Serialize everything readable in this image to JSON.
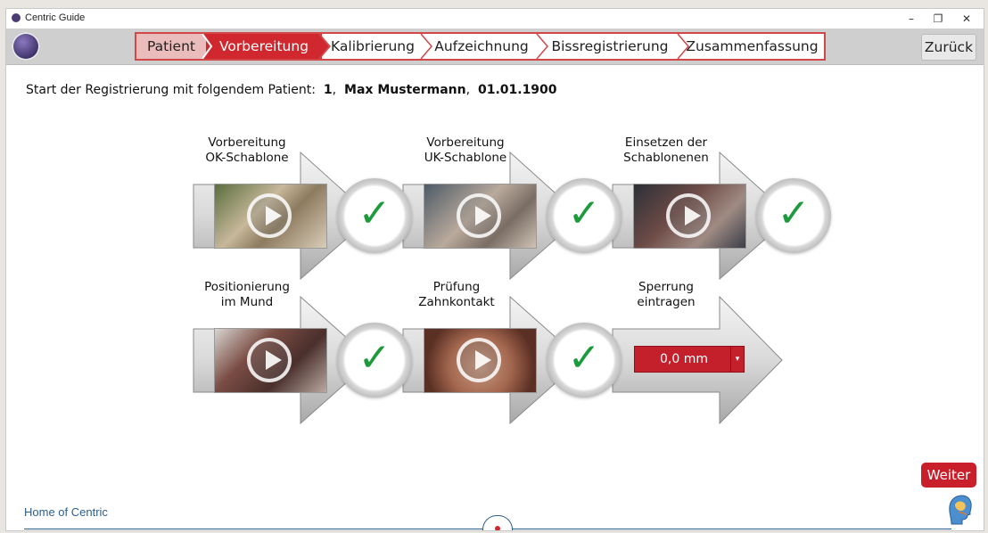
{
  "window": {
    "title": "Centric Guide",
    "minimize": "–",
    "maximize": "❐",
    "close": "✕"
  },
  "steps": [
    {
      "label": "Patient",
      "state": "done"
    },
    {
      "label": "Vorbereitung",
      "state": "active"
    },
    {
      "label": "Kalibrierung",
      "state": "todo"
    },
    {
      "label": "Aufzeichnung",
      "state": "todo"
    },
    {
      "label": "Bissregistrierung",
      "state": "todo"
    },
    {
      "label": "Zusammenfassung",
      "state": "todo"
    }
  ],
  "back_label": "Zurück",
  "intro": {
    "prefix": "Start der Registrierung mit folgendem Patient:",
    "id": "1",
    "sep1": ",",
    "name": "Max Mustermann",
    "sep2": ",",
    "dob": "01.01.1900"
  },
  "tiles": [
    {
      "line1": "Vorbereitung",
      "line2": "OK-Schablone"
    },
    {
      "line1": "Vorbereitung",
      "line2": "UK-Schablone"
    },
    {
      "line1": "Einsetzen der",
      "line2": "Schablonenen"
    },
    {
      "line1": "Positionierung",
      "line2": "im Mund"
    },
    {
      "line1": "Prüfung",
      "line2": "Zahnkontakt"
    },
    {
      "line1": "Sperrung",
      "line2": "eintragen"
    }
  ],
  "check_glyph": "✓",
  "sperrung": {
    "value": "0,0 mm",
    "dropdown": "▾"
  },
  "weiter_label": "Weiter",
  "footer": {
    "home_label": "Home of Centric"
  },
  "colors": {
    "accent": "#d0282e",
    "check": "#1d9a3c",
    "link": "#2c5f8d"
  }
}
